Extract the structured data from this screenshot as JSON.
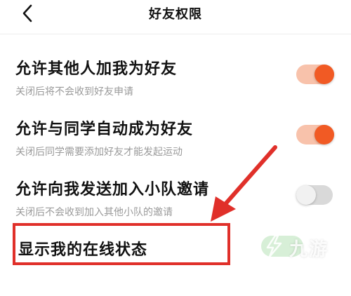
{
  "nav": {
    "title": "好友权限",
    "back_icon": "chevron-left-icon"
  },
  "settings": [
    {
      "title": "允许其他人加我为好友",
      "subtitle": "关闭后将不会收到好友申请",
      "enabled": true
    },
    {
      "title": "允许与同学自动成为好友",
      "subtitle": "关闭后同学需要添加好友才能发起运动",
      "enabled": true
    },
    {
      "title": "允许向我发送加入小队邀请",
      "subtitle": "关闭后不会收到加入其他小队的邀请",
      "enabled": false
    },
    {
      "title": "显示我的在线状态",
      "subtitle": "",
      "enabled": true
    }
  ],
  "colors": {
    "accent": "#f15a24",
    "annotation": "#e0302a"
  },
  "watermark": {
    "text": "九游"
  }
}
